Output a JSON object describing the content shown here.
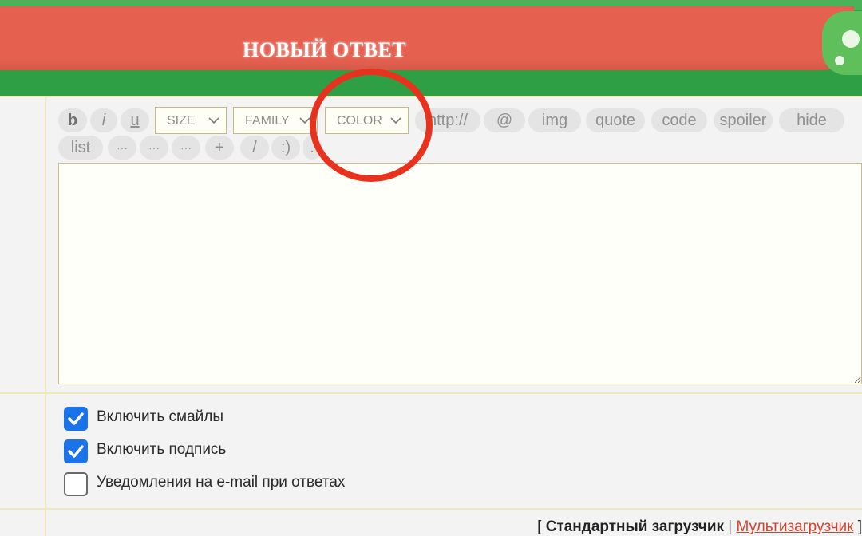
{
  "header": {
    "title": "НОВЫЙ ОТВЕТ"
  },
  "toolbar": {
    "bold": "b",
    "italic": "i",
    "underline": "u",
    "size": "SIZE",
    "family": "FAMILY",
    "color": "COLOR",
    "link": "http://",
    "email": "@",
    "img": "img",
    "quote": "quote",
    "code": "code",
    "spoiler": "spoiler",
    "hide": "hide",
    "list": "list",
    "dots1": "···",
    "dots2": "···",
    "dots3": "···",
    "plus": "+",
    "slash": "/",
    "smile": ":)",
    "dot": "."
  },
  "editor": {
    "value": ""
  },
  "options": [
    {
      "label": "Включить смайлы",
      "checked": true
    },
    {
      "label": "Включить подпись",
      "checked": true
    },
    {
      "label": "Уведомления на e-mail при ответах",
      "checked": false
    }
  ],
  "uploader": {
    "open_bracket": "[",
    "standard": "Стандартный загрузчик",
    "separator": "|",
    "multi": "Мультизагрузчик",
    "close_bracket": "]"
  },
  "annotation": {
    "color": "#e8321e"
  },
  "colors": {
    "banner_red": "#e5604f",
    "banner_green": "#2f9f45",
    "accent": "#1a73e8",
    "link": "#d2432e"
  }
}
